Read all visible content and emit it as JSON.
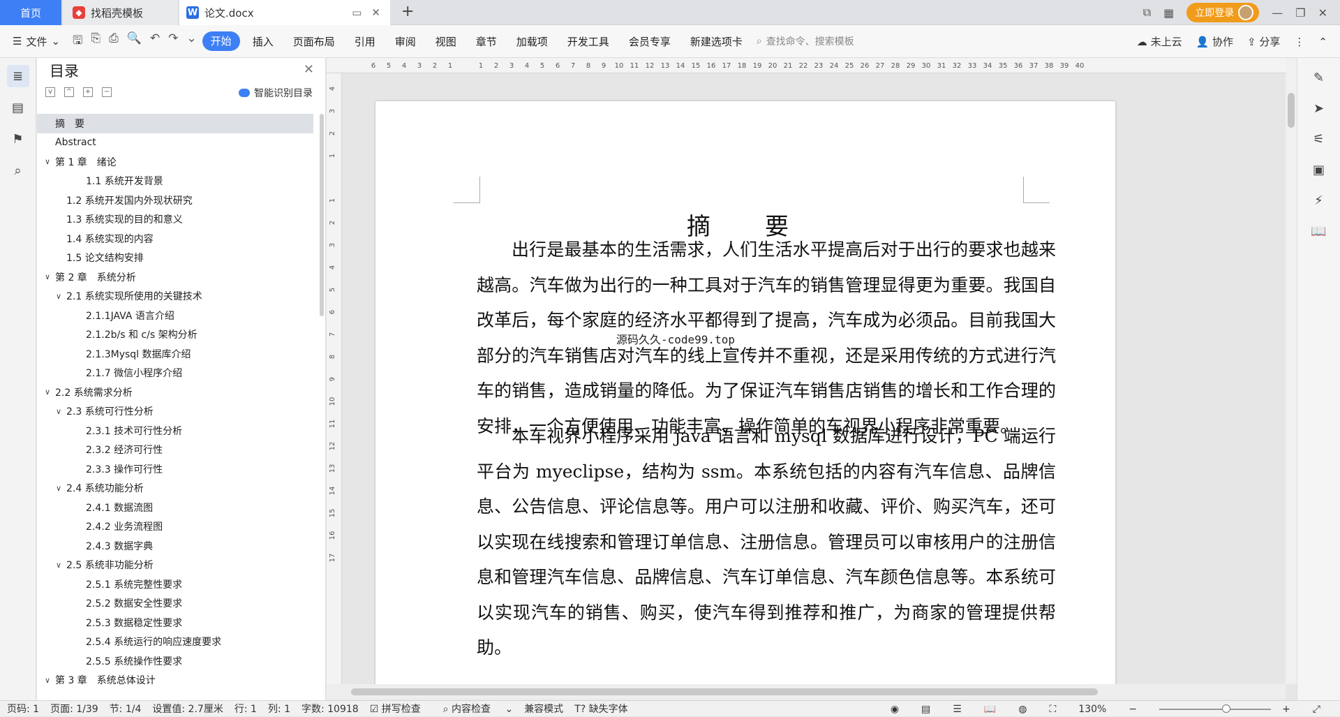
{
  "tabs": {
    "home": "首页",
    "template": "找稻壳模板",
    "doc": "论文.docx"
  },
  "title_right": {
    "login": "立即登录"
  },
  "toolbar": {
    "file": "文件",
    "menu": [
      "开始",
      "插入",
      "页面布局",
      "引用",
      "审阅",
      "视图",
      "章节",
      "加载项",
      "开发工具",
      "会员专享",
      "新建选项卡"
    ],
    "search_placeholder": "查找命令、搜索模板",
    "cloud": "未上云",
    "collab": "协作",
    "share": "分享"
  },
  "toc": {
    "title": "目录",
    "smart": "智能识别目录",
    "items": [
      {
        "text": "摘　要",
        "level": 1,
        "chev": ""
      },
      {
        "text": "Abstract",
        "level": 1,
        "chev": ""
      },
      {
        "text": "第 1 章　绪论",
        "level": 1,
        "chev": "v"
      },
      {
        "text": "1.1 系统开发背景",
        "level": 3,
        "chev": ""
      },
      {
        "text": "1.2 系统开发国内外现状研究",
        "level": 2,
        "chev": ""
      },
      {
        "text": "1.3 系统实现的目的和意义",
        "level": 2,
        "chev": ""
      },
      {
        "text": "1.4 系统实现的内容",
        "level": 2,
        "chev": ""
      },
      {
        "text": "1.5 论文结构安排",
        "level": 2,
        "chev": ""
      },
      {
        "text": "第 2 章　系统分析",
        "level": 1,
        "chev": "v"
      },
      {
        "text": "2.1 系统实现所使用的关键技术",
        "level": 2,
        "chev": "v"
      },
      {
        "text": "2.1.1JAVA 语言介绍",
        "level": 3,
        "chev": ""
      },
      {
        "text": "2.1.2b/s 和 c/s 架构分析",
        "level": 3,
        "chev": ""
      },
      {
        "text": "2.1.3Mysql 数据库介绍",
        "level": 3,
        "chev": ""
      },
      {
        "text": "2.1.7 微信小程序介绍",
        "level": 3,
        "chev": ""
      },
      {
        "text": "2.2 系统需求分析",
        "level": 1,
        "chev": "v"
      },
      {
        "text": "2.3 系统可行性分析",
        "level": 2,
        "chev": "v"
      },
      {
        "text": "2.3.1 技术可行性分析",
        "level": 3,
        "chev": ""
      },
      {
        "text": "2.3.2 经济可行性",
        "level": 3,
        "chev": ""
      },
      {
        "text": "2.3.3 操作可行性",
        "level": 3,
        "chev": ""
      },
      {
        "text": "2.4 系统功能分析",
        "level": 2,
        "chev": "v"
      },
      {
        "text": "2.4.1 数据流图",
        "level": 3,
        "chev": ""
      },
      {
        "text": "2.4.2  业务流程图",
        "level": 3,
        "chev": ""
      },
      {
        "text": "2.4.3 数据字典",
        "level": 3,
        "chev": ""
      },
      {
        "text": "2.5  系统非功能分析",
        "level": 2,
        "chev": "v"
      },
      {
        "text": "2.5.1 系统完整性要求",
        "level": 3,
        "chev": ""
      },
      {
        "text": "2.5.2 数据安全性要求",
        "level": 3,
        "chev": ""
      },
      {
        "text": "2.5.3 数据稳定性要求",
        "level": 3,
        "chev": ""
      },
      {
        "text": "2.5.4 系统运行的响应速度要求",
        "level": 3,
        "chev": ""
      },
      {
        "text": "2.5.5 系统操作性要求",
        "level": 3,
        "chev": ""
      },
      {
        "text": "第 3 章　系统总体设计",
        "level": 1,
        "chev": "v"
      }
    ]
  },
  "ruler": {
    "h_ticks": [
      "6",
      "5",
      "4",
      "3",
      "2",
      "1",
      "",
      "1",
      "2",
      "3",
      "4",
      "5",
      "6",
      "7",
      "8",
      "9",
      "10",
      "11",
      "12",
      "13",
      "14",
      "15",
      "16",
      "17",
      "18",
      "19",
      "20",
      "21",
      "22",
      "23",
      "24",
      "25",
      "26",
      "27",
      "28",
      "29",
      "30",
      "31",
      "32",
      "33",
      "34",
      "35",
      "36",
      "37",
      "38",
      "39",
      "40"
    ],
    "v_ticks": [
      "4",
      "3",
      "2",
      "1",
      "",
      "1",
      "2",
      "3",
      "4",
      "5",
      "6",
      "7",
      "8",
      "9",
      "10",
      "11",
      "12",
      "13",
      "14",
      "15",
      "16",
      "17"
    ]
  },
  "document": {
    "title": "摘　要",
    "para1": "出行是最基本的生活需求，人们生活水平提高后对于出行的要求也越来越高。汽车做为出行的一种工具对于汽车的销售管理显得更为重要。我国自改革后，每个家庭的经济水平都得到了提高，汽车成为必须品。目前我国大部分的汽车销售店对汽车的线上宣传并不重视，还是采用传统的方式进行汽车的销售，造成销量的降低。为了保证汽车销售店销售的增长和工作合理的安排，一个方便使用、功能丰富、操作简单的车视界小程序非常重要。",
    "para2": "本车视界小程序采用 java 语言和 mysql 数据库进行设计，PC 端运行平台为 myeclipse，结构为 ssm。本系统包括的内容有汽车信息、品牌信息、公告信息、评论信息等。用户可以注册和收藏、评价、购买汽车，还可以实现在线搜索和管理订单信息、注册信息。管理员可以审核用户的注册信息和管理汽车信息、品牌信息、汽车订单信息、汽车颜色信息等。本系统可以实现汽车的销售、购买，使汽车得到推荐和推广，为商家的管理提供帮助。",
    "watermark": "源码久久-code99.top"
  },
  "status": {
    "page": "页码: 1",
    "pages": "页面: 1/39",
    "section": "节: 1/4",
    "setting": "设置值: 2.7厘米",
    "row": "行: 1",
    "col": "列: 1",
    "words": "字数: 10918",
    "spell": "拼写检查",
    "content": "内容检查",
    "compat": "兼容模式",
    "font": "缺失字体",
    "zoom": "130%"
  }
}
